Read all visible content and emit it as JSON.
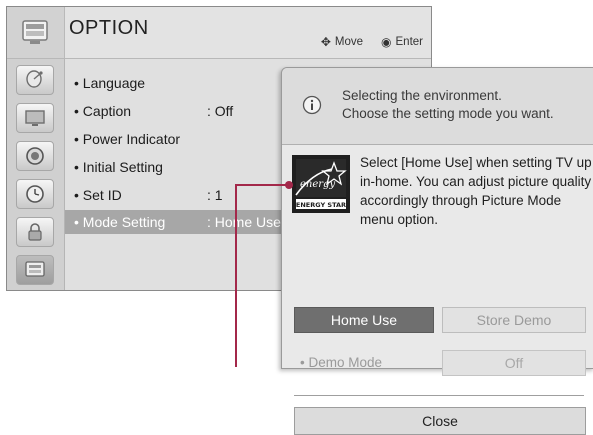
{
  "header": {
    "title": "OPTION",
    "move_label": "Move",
    "enter_label": "Enter",
    "move_icon": "four-way-arrow-icon",
    "enter_icon": "enter-dot-icon"
  },
  "sidebar": {
    "items": [
      {
        "icon": "satellite-dish-icon"
      },
      {
        "icon": "picture-screen-icon"
      },
      {
        "icon": "speaker-icon"
      },
      {
        "icon": "clock-icon"
      },
      {
        "icon": "lock-icon"
      },
      {
        "icon": "option-tv-icon",
        "active": true
      }
    ]
  },
  "menu": {
    "items": [
      {
        "label": "• Language",
        "value": ""
      },
      {
        "label": "• Caption",
        "value": ": Off"
      },
      {
        "label": "• Power Indicator",
        "value": ""
      },
      {
        "label": "• Initial Setting",
        "value": ""
      },
      {
        "label": "• Set ID",
        "value": ": 1"
      },
      {
        "label": "• Mode Setting",
        "value": ": Home Use",
        "selected": true
      }
    ]
  },
  "popup": {
    "info_line1": "Selecting the environment.",
    "info_line2": "Choose the setting mode you want.",
    "description": "Select [Home Use] when setting TV up in-home. You can adjust picture quality accordingly through Picture Mode menu option.",
    "energy_star_label": "ENERGY STAR",
    "energy_star_script": "energy",
    "home_use_label": "Home Use",
    "store_demo_label": "Store Demo",
    "demo_mode_label": "• Demo Mode",
    "demo_mode_value": "Off",
    "close_label": "Close"
  },
  "colors": {
    "callout": "#a3284a",
    "selected_row": "#a7a7a7",
    "home_use_button": "#6f6f6f"
  }
}
